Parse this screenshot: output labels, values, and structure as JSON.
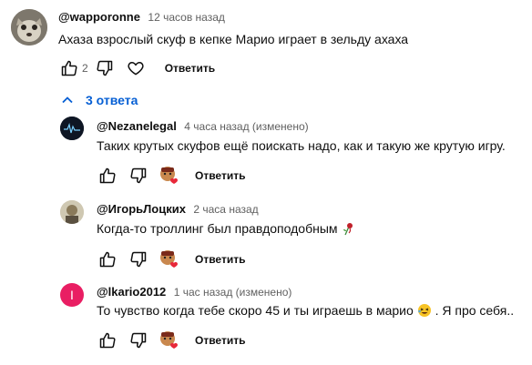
{
  "labels": {
    "reply": "Ответить",
    "replies_toggle": "3 ответа"
  },
  "comments": [
    {
      "author": "@wapporonne",
      "time": "12 часов назад",
      "text": "Ахаза взрослый скуф в кепке Марио играет в зельду ахаха",
      "likes": "2"
    }
  ],
  "replies": [
    {
      "author": "@Nezanelegal",
      "time": "4 часа назад (изменено)",
      "text": "Таких крутых скуфов ещё поискать надо, как и такую же крутую игру."
    },
    {
      "author": "@ИгорьЛоцких",
      "time": "2 часа назад",
      "text": "Когда-то троллинг был правдоподобным"
    },
    {
      "author": "@lkario2012",
      "time": "1 час назад (изменено)",
      "text_before": "То чувство когда тебе скоро 45 и ты играешь в марио",
      "text_after": ". Я про себя..",
      "avatar_letter": "I"
    }
  ],
  "colors": {
    "link_blue": "#065fd4",
    "meta_gray": "#606060",
    "avatar_pink": "#e91e63"
  }
}
